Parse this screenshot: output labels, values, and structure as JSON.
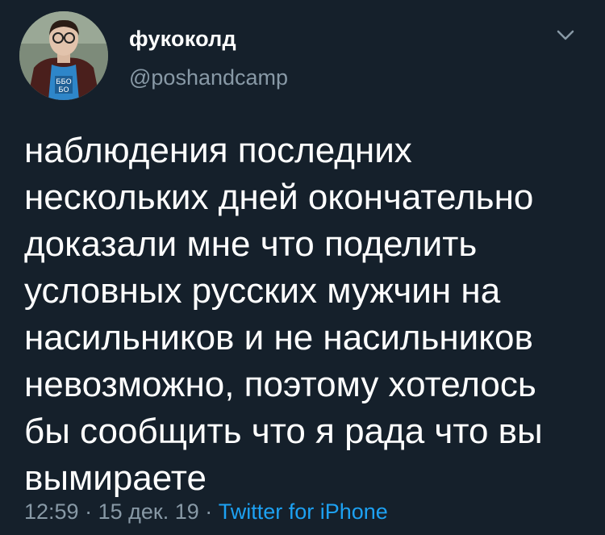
{
  "author": {
    "display_name": "фукоколд",
    "handle": "@poshandcamp",
    "avatar_icon": "user-avatar",
    "avatar_shirt_text": [
      "ББО",
      "БО"
    ]
  },
  "more_icon": "chevron-down-icon",
  "tweet": {
    "lines": [
      "наблюдения последних",
      "нескольких дней окончательно",
      "доказали мне что поделить",
      "условных русских мужчин на",
      "насильников и не насильников",
      "невозможно, поэтому хотелось",
      "бы сообщить что я рада что вы",
      "вымираете"
    ]
  },
  "meta": {
    "time": "12:59",
    "separator": " · ",
    "date": "15 дек. 19",
    "source": "Twitter for iPhone"
  },
  "colors": {
    "background": "#15202b",
    "text": "#ffffff",
    "secondary": "#8899a6",
    "link": "#1da1f2"
  }
}
